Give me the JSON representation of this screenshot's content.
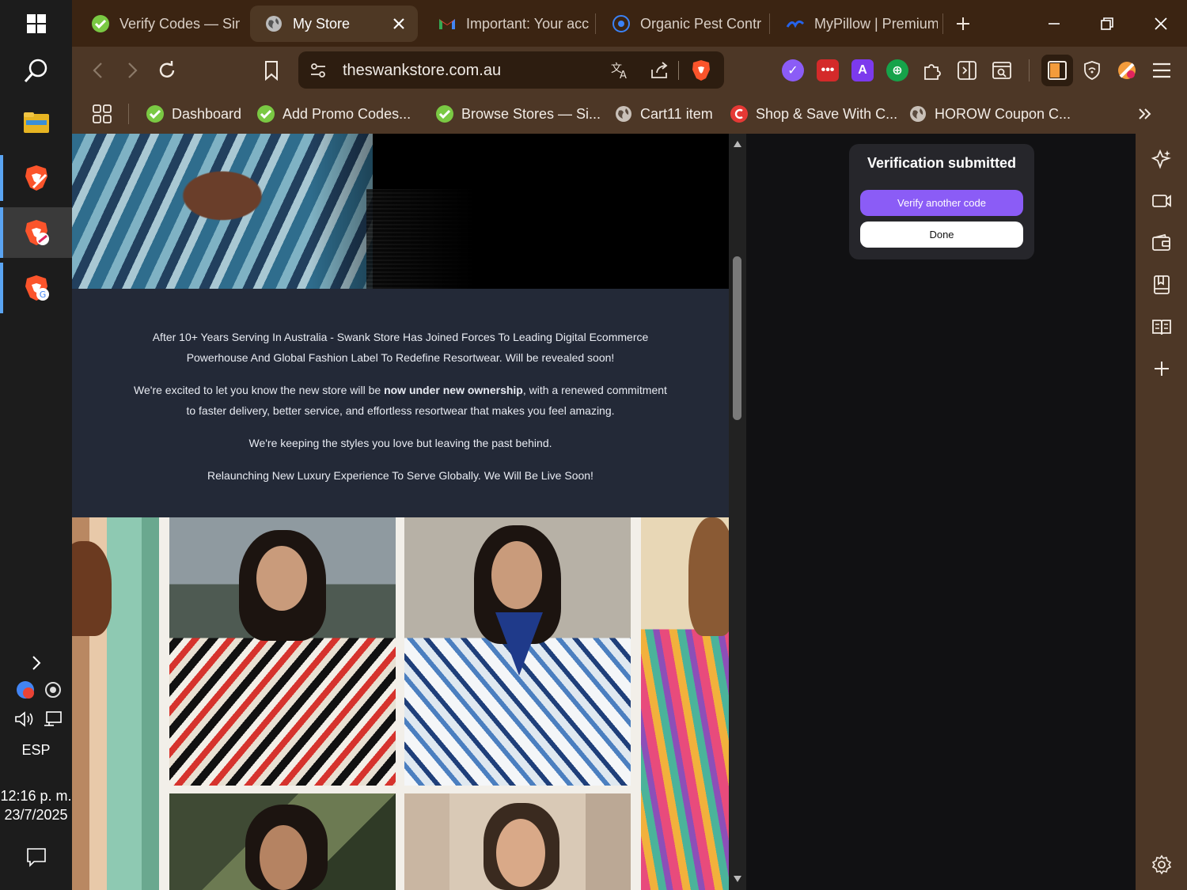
{
  "taskbar": {
    "language": "ESP",
    "time": "12:16 p. m.",
    "date": "23/7/2025"
  },
  "tabs": [
    {
      "title": "Verify Codes — Sim",
      "icon": "green-check-icon"
    },
    {
      "title": "My Store",
      "icon": "globe-icon",
      "active": true
    },
    {
      "title": "Important: Your acc",
      "icon": "gmail-icon"
    },
    {
      "title": "Organic Pest Contr",
      "icon": "pest-logo-icon"
    },
    {
      "title": "MyPillow | Premium",
      "icon": "mypillow-logo-icon"
    }
  ],
  "toolbar": {
    "url": "theswankstore.com.au"
  },
  "bookmarks": [
    {
      "label": "Dashboard",
      "icon": "green-check-icon"
    },
    {
      "label": "Add Promo Codes...",
      "icon": "green-check-icon"
    },
    {
      "label": "Browse Stores — Si...",
      "icon": "green-check-icon"
    },
    {
      "label": "Cart11 item",
      "icon": "globe-icon"
    },
    {
      "label": "Shop & Save With C...",
      "icon": "red-c-icon"
    },
    {
      "label": "HOROW Coupon C...",
      "icon": "globe-icon"
    }
  ],
  "announcement": {
    "p1_line1": "After 10+ Years Serving In Australia - Swank Store Has Joined Forces To Leading Digital Ecommerce",
    "p1_line2": "Powerhouse And Global Fashion Label To Redefine Resortwear. Will be revealed soon!",
    "p2_before": "We're excited to let you know the new store will be ",
    "p2_bold": "now under new ownership",
    "p2_after": ", with a renewed commitment",
    "p2_line2": "to faster delivery, better service, and effortless resortwear that makes you feel amazing.",
    "p3": "We're keeping the styles you love but leaving the past behind.",
    "p4": "Relaunching New Luxury Experience To Serve Globally. We Will Be Live Soon!"
  },
  "verify_panel": {
    "title": "Verification submitted",
    "verify_another": "Verify another code",
    "done": "Done"
  },
  "colors": {
    "tabstrip": "#3b2412",
    "toolbar": "#4d3726",
    "page_bg": "#232937",
    "accent_purple": "#8b5cf6"
  }
}
